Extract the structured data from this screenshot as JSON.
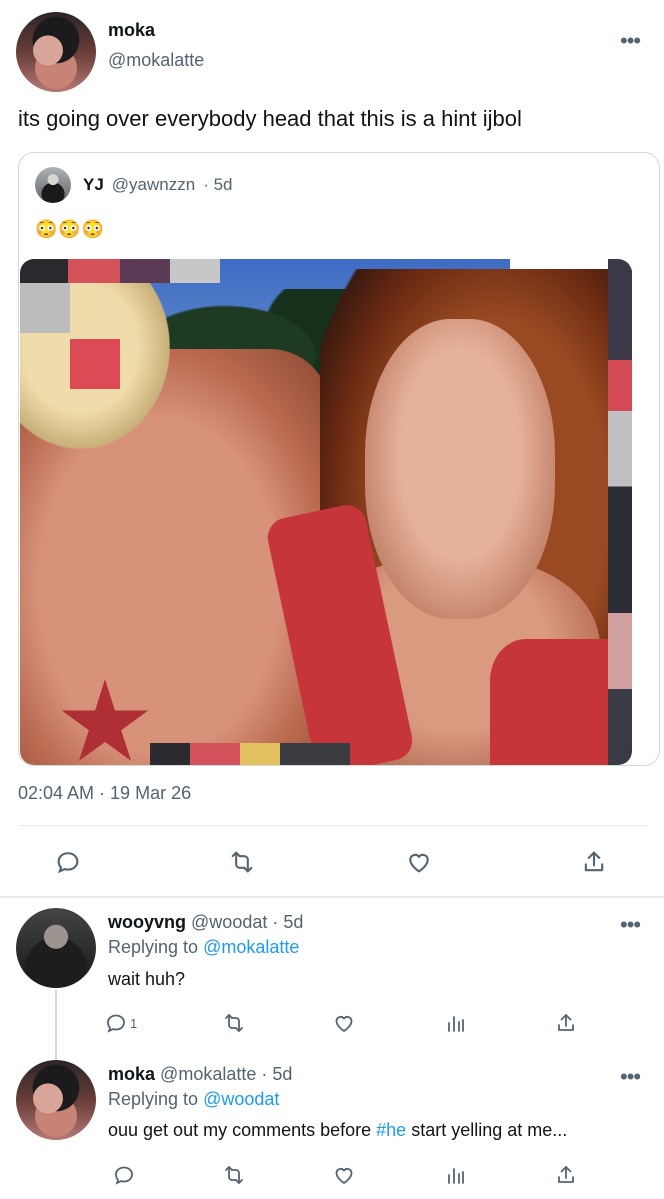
{
  "main_tweet": {
    "display_name": "moka",
    "handle": "@mokalatte",
    "text": "its going over everybody head that this is a hint ijbol",
    "timestamp": "02:04 AM · 19 Mar 26",
    "more_icon": "•••"
  },
  "quoted_tweet": {
    "display_name": "YJ",
    "handle": "@yawnzzn",
    "time": "· 5d",
    "text": "😳😳😳"
  },
  "replies": [
    {
      "display_name": "wooyvng",
      "handle": "@woodat",
      "time": "· 5d",
      "replying_label": "Replying to",
      "replying_to": "@mokalatte",
      "text": "wait huh?",
      "reply_count": "1"
    },
    {
      "display_name": "moka",
      "handle": "@mokalatte",
      "time": "· 5d",
      "replying_label": "Replying to",
      "replying_to": "@woodat",
      "text_before": "ouu get out my comments before ",
      "hashtag": "#he",
      "text_after": " start yelling at me..."
    }
  ],
  "icons": {
    "reply": "reply-icon",
    "retweet": "retweet-icon",
    "like": "like-icon",
    "share": "share-icon",
    "analytics": "analytics-icon",
    "more": "more-icon"
  },
  "colors": {
    "text": "#0f1419",
    "secondary": "#536471",
    "link": "#1d9bf0",
    "divider": "#e6ecf0"
  }
}
